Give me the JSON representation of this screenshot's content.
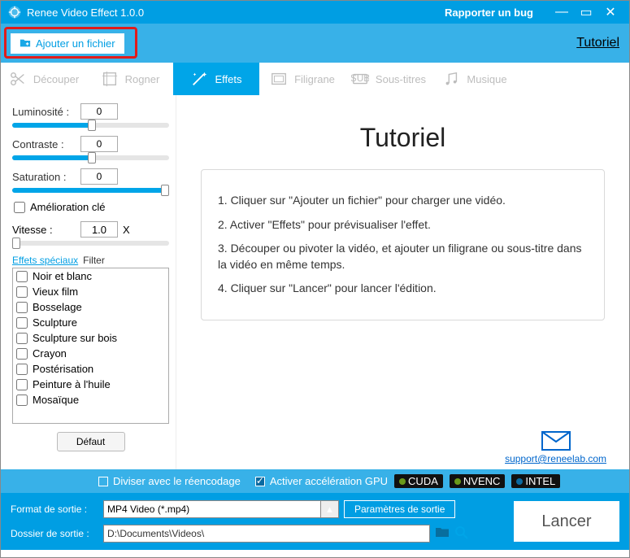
{
  "title": "Renee Video Effect 1.0.0",
  "bug_report": "Rapporter un bug",
  "toolbar": {
    "add_file": "Ajouter un fichier",
    "tutorial_link": "Tutoriel"
  },
  "tabs": [
    {
      "label": "Découper"
    },
    {
      "label": "Rogner"
    },
    {
      "label": "Effets"
    },
    {
      "label": "Filigrane"
    },
    {
      "label": "Sous-titres"
    },
    {
      "label": "Musique"
    }
  ],
  "sliders": {
    "brightness_label": "Luminosité :",
    "brightness_value": "0",
    "contrast_label": "Contraste :",
    "contrast_value": "0",
    "saturation_label": "Saturation :",
    "saturation_value": "0",
    "key_improve": "Amélioration clé",
    "speed_label": "Vitesse :",
    "speed_value": "1.0",
    "speed_unit": "X",
    "fx_link": "Effets spéciaux",
    "filter_label": "Filter"
  },
  "fxlist": [
    "Noir et blanc",
    "Vieux film",
    "Bosselage",
    "Sculpture",
    "Sculpture sur bois",
    "Crayon",
    "Postérisation",
    "Peinture à l'huile",
    "Mosaïque"
  ],
  "default_btn": "Défaut",
  "tutorial": {
    "heading": "Tutoriel",
    "s1": "1. Cliquer sur \"Ajouter un fichier\" pour charger une vidéo.",
    "s2": "2. Activer \"Effets\" pour prévisualiser l'effet.",
    "s3": "3. Découper ou pivoter la vidéo, et ajouter un filigrane ou sous-titre dans la vidéo en même temps.",
    "s4": "4. Cliquer sur \"Lancer\" pour lancer l'édition.",
    "support_email": "support@reneelab.com"
  },
  "options": {
    "split_label": "Diviser avec le réencodage",
    "gpu_label": "Activer accélération GPU",
    "badges": [
      "CUDA",
      "NVENC",
      "INTEL"
    ]
  },
  "bottom": {
    "format_label": "Format de sortie :",
    "format_value": "MP4 Video (*.mp4)",
    "params_btn": "Paramètres de sortie",
    "folder_label": "Dossier de sortie :",
    "folder_value": "D:\\Documents\\Videos\\",
    "launch": "Lancer"
  }
}
